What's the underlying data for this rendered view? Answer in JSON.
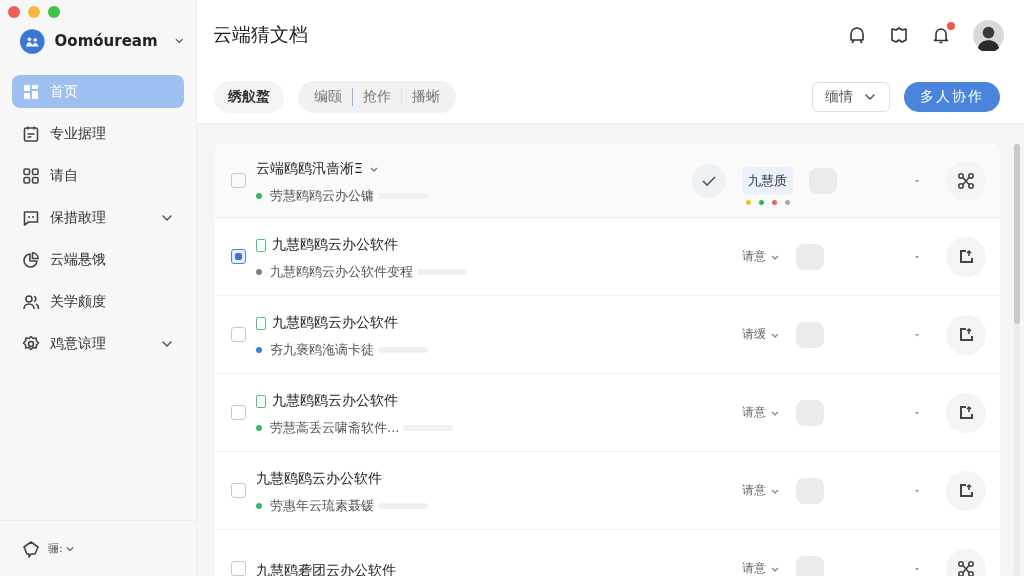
{
  "window": {
    "title": "云端猜文档"
  },
  "sidebar": {
    "workspace": "Oomóuream",
    "items": [
      {
        "label": "首页",
        "selected": true,
        "expandable": false
      },
      {
        "label": "专业据理",
        "selected": false,
        "expandable": false
      },
      {
        "label": "请自",
        "selected": false,
        "expandable": false
      },
      {
        "label": "保措敢理",
        "selected": false,
        "expandable": true
      },
      {
        "label": "云端悬饿",
        "selected": false,
        "expandable": false
      },
      {
        "label": "关学颇度",
        "selected": false,
        "expandable": false
      },
      {
        "label": "鸡意谅理",
        "selected": false,
        "expandable": true
      }
    ],
    "footer": "骊:"
  },
  "header": {
    "notification_badge": true
  },
  "toolbar": {
    "view_button": "绣舣蝥",
    "segments": [
      {
        "label": "编颐",
        "selected": false
      },
      {
        "label": "抢作",
        "selected": false
      },
      {
        "label": "播蜥",
        "selected": false
      }
    ],
    "filter": "缅情",
    "primary_button": "多人协作"
  },
  "rows": [
    {
      "kind": "featured",
      "selected": true,
      "checked": false,
      "title": "云端鸥鸥汛啬淅Ξ",
      "title_marker": false,
      "subtitle": "劳慧鸥鸥云办公镛",
      "color": "#3cb371",
      "tag": "九慧质",
      "tag_dots": [
        {
          "color": "#e6c619"
        },
        {
          "color": "#2fb84a"
        },
        {
          "color": "#f0654f"
        },
        {
          "color": "#a8a8a8"
        }
      ],
      "action": {
        "kind": "share"
      }
    },
    {
      "kind": "plain",
      "selected": false,
      "checked": true,
      "title": "九慧鸥鸥云办公软件",
      "title_marker": true,
      "subtitle": "九慧鸥鸥云办公软件变程",
      "color": "#808080",
      "status": "请意",
      "action": {
        "kind": "upload"
      }
    },
    {
      "kind": "plain",
      "selected": false,
      "checked": false,
      "title": "九慧鸥鸥云办公软件",
      "title_marker": true,
      "subtitle": "夯九褒鸥沲谪卡徒",
      "color": "#3b7ddd",
      "status": "请缓",
      "action": {
        "kind": "upload"
      }
    },
    {
      "kind": "plain",
      "selected": false,
      "checked": false,
      "title": "九慧鸥鸥云办公软件",
      "title_marker": true,
      "subtitle": "劳慧蒿丢云啸斋软件...",
      "color": "#3cb371",
      "status": "请意",
      "action": {
        "kind": "upload"
      }
    },
    {
      "kind": "plain",
      "selected": false,
      "checked": false,
      "title": "九慧鸥鸥云办公软件",
      "title_marker": false,
      "subtitle": "劳惠年云琉素聂锾",
      "color": "#3cb371",
      "status": "请意",
      "action": {
        "kind": "upload"
      }
    },
    {
      "kind": "plain",
      "selected": false,
      "checked": false,
      "title": "九慧鸥砻团云办公软件",
      "title_marker": false,
      "status": "请意",
      "action": {
        "kind": "share"
      }
    }
  ]
}
